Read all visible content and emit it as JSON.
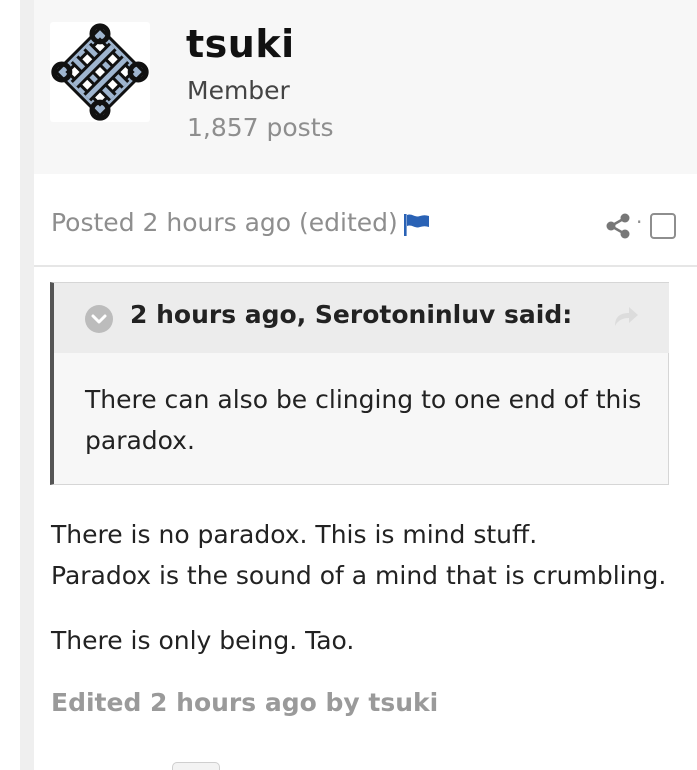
{
  "author": {
    "name": "tsuki",
    "role": "Member",
    "posts": "1,857 posts",
    "avatar_icon": "endless-knot-icon"
  },
  "post_meta": {
    "posted_text": "Posted 2 hours ago (edited) ·",
    "flag_icon": "flag-icon",
    "flag_color": "#2a62b5",
    "share_icon": "share-icon",
    "share_separator": "·"
  },
  "quote": {
    "citation": "2 hours ago, Serotoninluv said:",
    "text": "There can also be clinging to one end of this paradox."
  },
  "body": {
    "line1": "There is no paradox. This is mind stuff.",
    "line2": "Paradox is the sound of a mind that is crumbling.",
    "line3": "There is only being. Tao."
  },
  "edited_note": "Edited 2 hours ago by tsuki"
}
